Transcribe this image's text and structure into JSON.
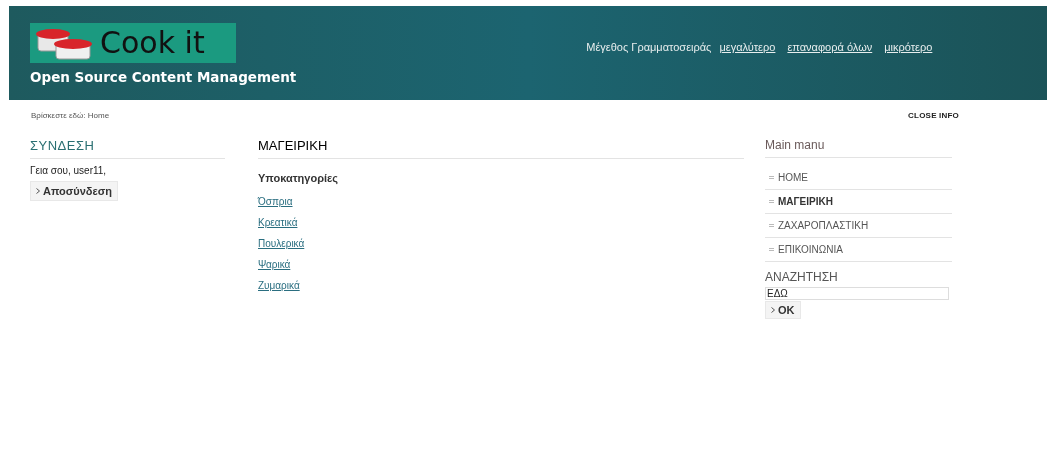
{
  "header": {
    "logo_text": "Cook it",
    "tagline": "Open Source Content Management",
    "font_size": {
      "label": "Μέγεθος Γραμματοσειράς",
      "links": [
        "μεγαλύτερο",
        "επαναφορά όλων",
        "μικρότερο"
      ]
    }
  },
  "breadcrumb": "Βρίσκεστε εδώ: Home",
  "close_info": "CLOSE INFO",
  "login": {
    "title": "ΣΥΝΔΕΣΗ",
    "greeting": "Γεια σου, user11,",
    "button": "Αποσύνδεση"
  },
  "content": {
    "title": "ΜΑΓΕΙΡΙΚΗ",
    "subtitle": "Υποκατηγορίες",
    "links": [
      "Όσπρια",
      "Κρεατικά",
      "Πουλερικά",
      "Ψαρικά",
      "Ζυμαρικά"
    ]
  },
  "main_menu": {
    "title": "Main manu",
    "items": [
      {
        "label": "HOME",
        "selected": false
      },
      {
        "label": "ΜΑΓΕΙΡΙΚΗ",
        "selected": true
      },
      {
        "label": "ΖΑΧΑΡΟΠΛΑΣΤΙΚΗ",
        "selected": false
      },
      {
        "label": "ΕΠΙΚΟΙΝΩΝΙΑ",
        "selected": false
      }
    ]
  },
  "search": {
    "title": "ΑΝΑΖΗΤΗΣΗ",
    "value": "ΕΔΩ",
    "button": "OK"
  }
}
